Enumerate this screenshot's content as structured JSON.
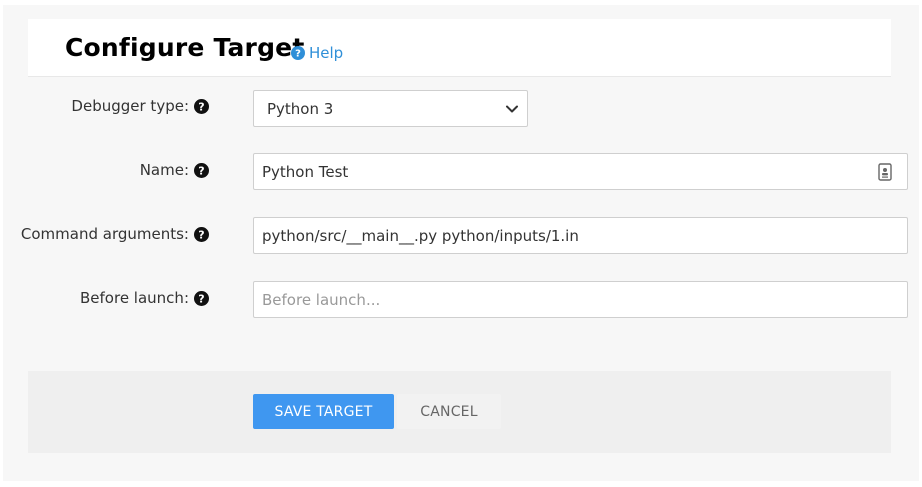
{
  "header": {
    "title": "Configure Target",
    "help_label": "Help",
    "help_icon": "question-circle-icon"
  },
  "form": {
    "debugger_type": {
      "label": "Debugger type:",
      "help_icon": "question-circle-icon",
      "selected": "Python 3",
      "dropdown_icon": "chevron-down-icon"
    },
    "name": {
      "label": "Name:",
      "help_icon": "question-circle-icon",
      "value": "Python Test",
      "trailing_icon": "contact-card-icon"
    },
    "command_arguments": {
      "label": "Command arguments:",
      "help_icon": "question-circle-icon",
      "value": "python/src/__main__.py python/inputs/1.in"
    },
    "before_launch": {
      "label": "Before launch:",
      "help_icon": "question-circle-icon",
      "value": "",
      "placeholder": "Before launch..."
    }
  },
  "footer": {
    "save_label": "SAVE TARGET",
    "cancel_label": "CANCEL"
  },
  "colors": {
    "primary": "#3f97f0",
    "link": "#2f8fd8",
    "panel_bg": "#f7f7f7",
    "footer_bg": "#efefef"
  }
}
